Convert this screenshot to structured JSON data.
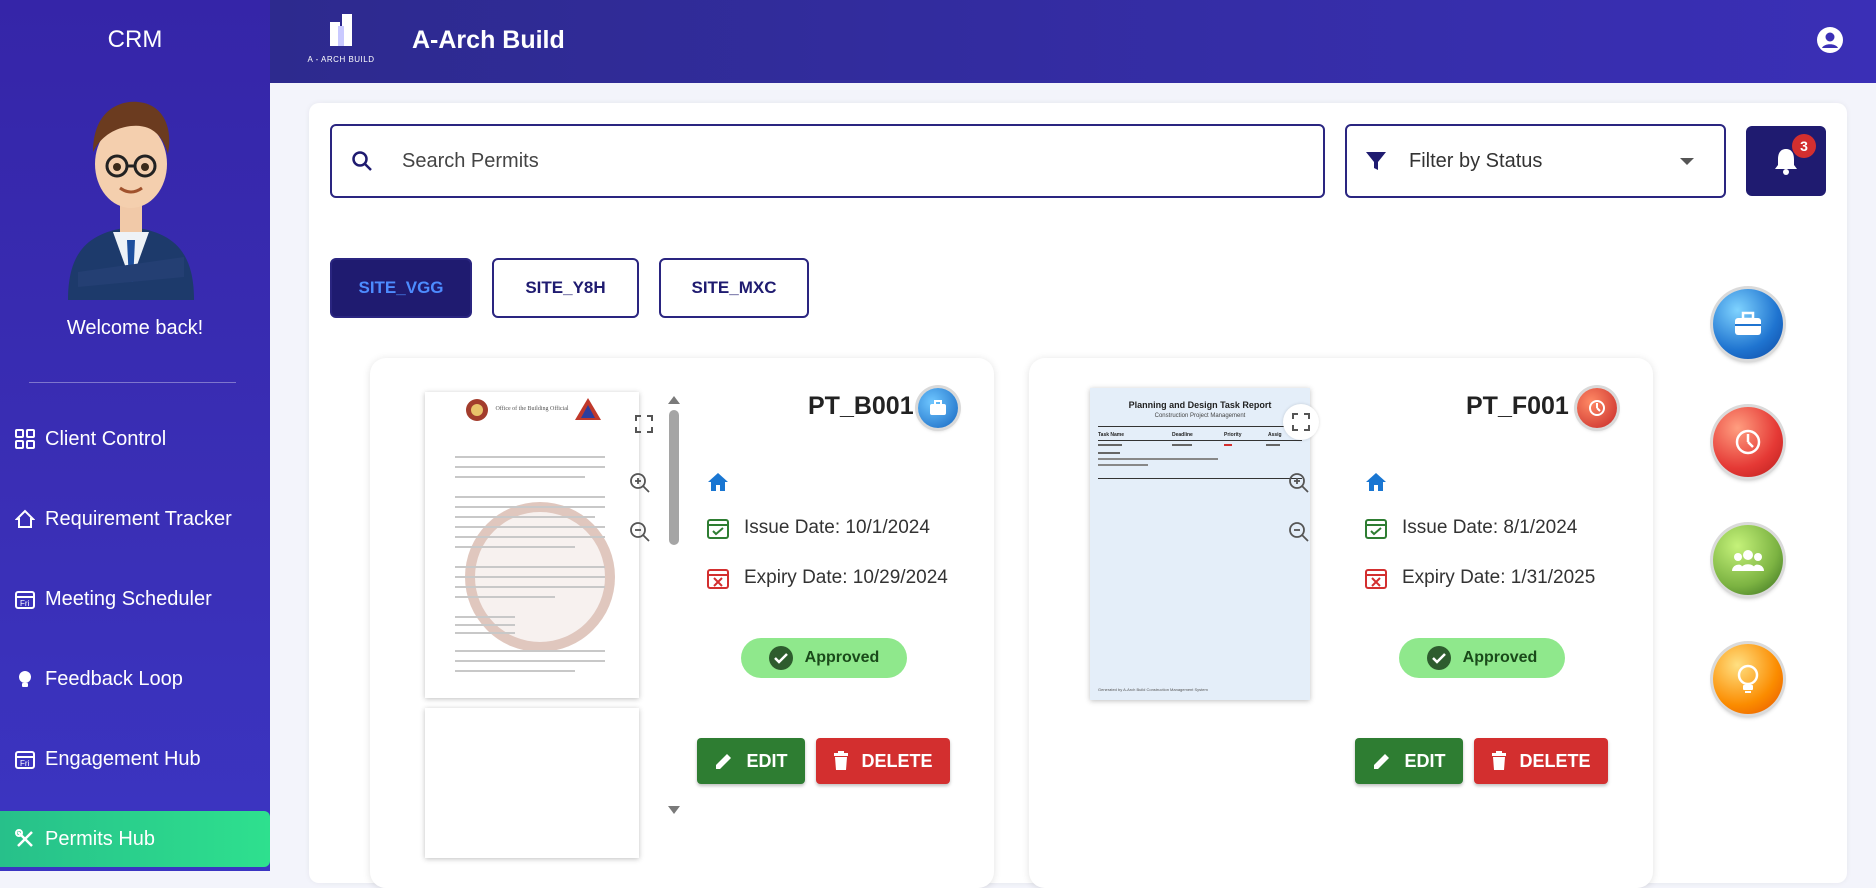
{
  "sidebar": {
    "brand": "CRM",
    "welcome": "Welcome back!",
    "items": [
      {
        "label": "Client Control",
        "icon": "grid-icon"
      },
      {
        "label": "Requirement Tracker",
        "icon": "home-outline-icon"
      },
      {
        "label": "Meeting Scheduler",
        "icon": "calendar-icon"
      },
      {
        "label": "Feedback Loop",
        "icon": "lightbulb-icon"
      },
      {
        "label": "Engagement Hub",
        "icon": "calendar-icon"
      },
      {
        "label": "Permits Hub",
        "icon": "tools-icon",
        "active": true
      }
    ]
  },
  "header": {
    "logo_text": "A - ARCH BUILD",
    "title": "A-Arch Build"
  },
  "search": {
    "placeholder": "Search Permits",
    "value": ""
  },
  "filter": {
    "label": "Filter by Status"
  },
  "notifications": {
    "count": "3"
  },
  "site_tabs": [
    {
      "label": "SITE_VGG",
      "active": true
    },
    {
      "label": "SITE_Y8H",
      "active": false
    },
    {
      "label": "SITE_MXC",
      "active": false
    }
  ],
  "permits": [
    {
      "id": "PT_B001",
      "issue": "Issue Date: 10/1/2024",
      "expiry": "Expiry Date: 10/29/2024",
      "status": "Approved",
      "edit_label": "EDIT",
      "delete_label": "DELETE",
      "orb_color": "#1e88e5",
      "doc_title": "Office of the Building Official"
    },
    {
      "id": "PT_F001",
      "issue": "Issue Date: 8/1/2024",
      "expiry": "Expiry Date: 1/31/2025",
      "status": "Approved",
      "edit_label": "EDIT",
      "delete_label": "DELETE",
      "orb_color": "#e53935",
      "doc_title": "Planning and Design Task Report",
      "doc_subtitle": "Construction Project Management",
      "doc_cols": [
        "Task Name",
        "Deadline",
        "Priority",
        "Assig"
      ],
      "doc_footer": "Generated by A-Arch Build Construction Management System"
    }
  ],
  "colors": {
    "primary": "#1f1b70",
    "accent_blue": "#4d8cff",
    "success": "#2e7d32",
    "danger": "#d32f2f",
    "status_bg": "#8fe88c"
  }
}
